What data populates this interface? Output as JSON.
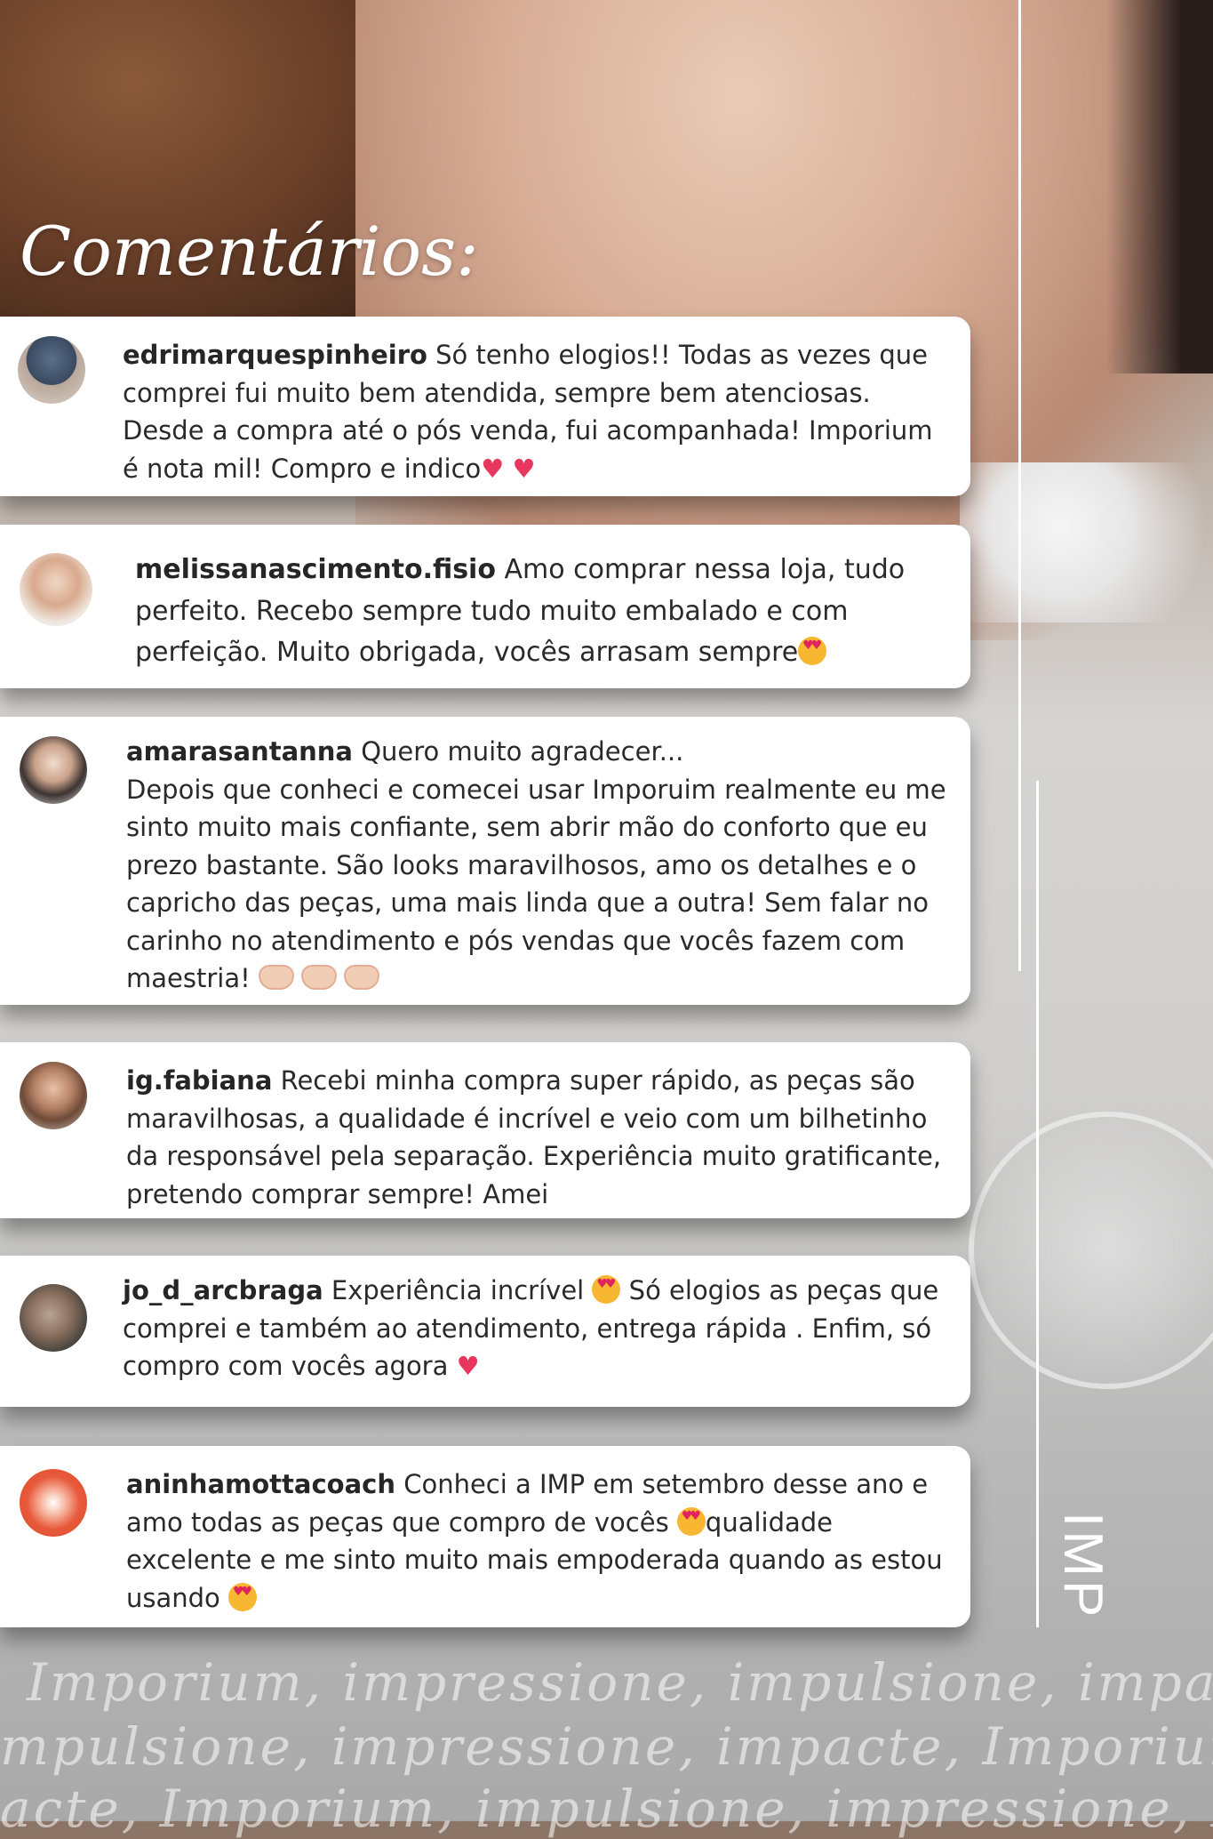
{
  "header": {
    "title": "Comentários:"
  },
  "brand": {
    "logo_text": "IMP"
  },
  "comments": [
    {
      "username": "edrimarquespinheiro",
      "lines": [
        " Só tenho elogios!! Todas as vezes que",
        "comprei fui muito bem atendida, sempre bem atenciosas.",
        "Desde a compra até o pós venda, fui acompanhada! Imporium",
        "é nota mil! Compro e indico"
      ],
      "emojis": [
        "red-heart",
        "red-heart"
      ]
    },
    {
      "username": "melissanascimento.fisio",
      "lines": [
        " Amo comprar nessa loja, tudo",
        "perfeito. Recebo sempre tudo muito embalado e com",
        "perfeição. Muito obrigada, vocês arrasam sempre"
      ],
      "emojis": [
        "heart-eyes"
      ]
    },
    {
      "username": "amarasantanna",
      "lines": [
        " Quero muito agradecer...",
        "Depois que conheci e comecei usar Imporuim realmente eu me",
        "sinto muito mais confiante, sem abrir mão do conforto que eu",
        "prezo bastante. São looks maravilhosos, amo os detalhes e o",
        "capricho das peças, uma mais linda que a outra! Sem falar no",
        "carinho no atendimento e pós vendas que vocês fazem com",
        "maestria!"
      ],
      "emojis": [
        "heart-hands",
        "heart-hands",
        "heart-hands"
      ]
    },
    {
      "username": "ig.fabiana",
      "lines": [
        " Recebi minha compra super rápido, as peças são",
        "maravilhosas, a qualidade é incrível e veio com um bilhetinho",
        "da responsável pela separação. Experiência muito gratificante,",
        "pretendo comprar sempre! Amei"
      ],
      "emojis": []
    },
    {
      "username": "jo_d_arcbraga",
      "lines": [
        " Experiência incrível",
        " Só elogios as peças que",
        "comprei e também ao atendimento, entrega rápida . Enfim, só",
        "compro com vocês agora"
      ],
      "emojis": [
        "heart-eyes",
        "red-heart"
      ]
    },
    {
      "username": "aninhamottacoach",
      "lines": [
        " Conheci a IMP em setembro desse ano e",
        "amo todas as peças que compro de vocês",
        "qualidade",
        "excelente e me sinto muito mais empoderada quando as estou",
        "usando"
      ],
      "emojis": [
        "heart-eyes",
        "heart-eyes"
      ]
    }
  ],
  "footer": {
    "tagline_rows": [
      "Imporium, impressione, impulsione, impac",
      "mpulsione, impressione, impacte, Imporium",
      "acte, Imporium, impulsione, impressione, I"
    ]
  },
  "colors": {
    "card_background": "#ffffff",
    "text": "#262626",
    "heart": "#e8375f",
    "title": "#ffffff"
  }
}
